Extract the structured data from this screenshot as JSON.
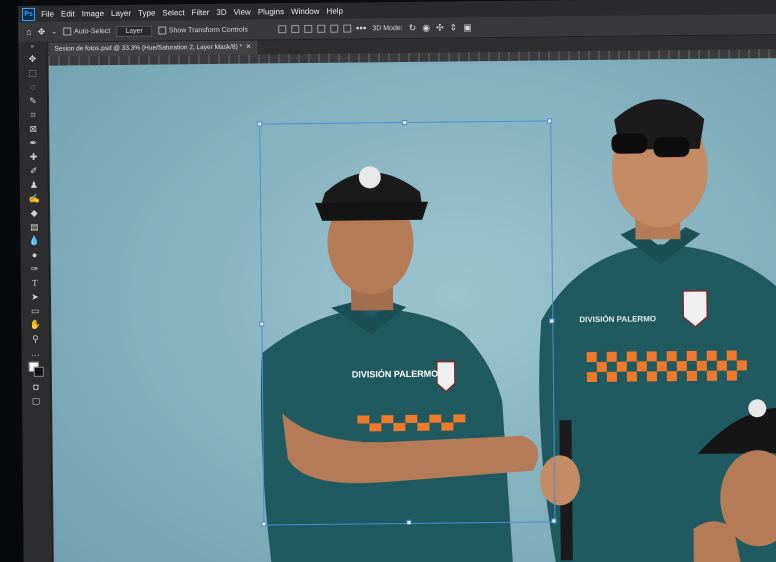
{
  "menu": {
    "items": [
      "File",
      "Edit",
      "Image",
      "Layer",
      "Type",
      "Select",
      "Filter",
      "3D",
      "View",
      "Plugins",
      "Window",
      "Help"
    ]
  },
  "options": {
    "auto_select": "Auto-Select",
    "auto_select_target": "Layer",
    "show_transform": "Show Transform Controls",
    "mode_label": "3D Mode:"
  },
  "document": {
    "tab_title": "Sesion de fotos.psd @ 33.3% (Hue/Saturation 2, Layer Mask/8) *"
  },
  "tools": [
    "move",
    "marquee",
    "lasso",
    "quick-select",
    "crop",
    "frame",
    "eyedropper",
    "healing",
    "brush",
    "stamp",
    "history-brush",
    "eraser",
    "gradient",
    "blur",
    "dodge",
    "pen",
    "type",
    "path-select",
    "shape",
    "hand",
    "zoom",
    "more"
  ],
  "colors": {
    "canvas_bg": "#87b4c1",
    "polo": "#1f5a60",
    "checker_orange": "#f07a2a",
    "selection": "#4b8fd9"
  },
  "photo": {
    "badge_text": "DIVISIÓN PALERMO",
    "badge_text_2": "DIVISIÓN PALERMO"
  }
}
